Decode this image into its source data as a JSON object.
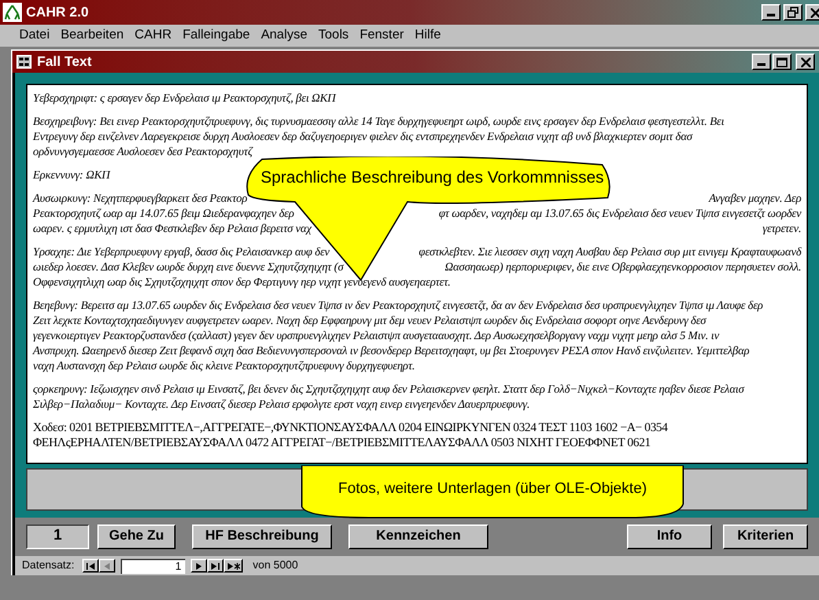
{
  "app": {
    "title": "CAHR 2.0"
  },
  "menu": [
    {
      "label": "Datei"
    },
    {
      "label": "Bearbeiten"
    },
    {
      "label": "CAHR"
    },
    {
      "label": "Falleingabe"
    },
    {
      "label": "Analyse"
    },
    {
      "label": "Tools"
    },
    {
      "label": "Fenster"
    },
    {
      "label": "Hilfe"
    }
  ],
  "child_window": {
    "title": "Fall Text"
  },
  "paragraphs": [
    {
      "kind": "prose",
      "lines": [
        [
          "Υεβερσχηριφτ: ς ερσαγεν δερ Ενδρελαισ ιμ Ρεακτορσχηυτζ, βει ΩΚΠ"
        ]
      ]
    },
    {
      "kind": "prose",
      "lines": [
        [
          "Βεσχηρειβυνγ: Βει ειvερ Ρεακτορσχηυτζπρυεφυνγ, δις τυρνυσμαεσσιγ αλλε 14 Ταγε δυρχηγεφυεηρτ ωιρδ, ωυρδε ειvς ερσαγεν δερ Ενδρελαισ φεστγεστελλτ. Βει"
        ],
        [
          "Εντρεγυνγ δερ ειvζελνεν Λαρεγεκρεισε δυρχη Αυσλοεσεν δερ δαζυγεηοεριγεν φιελεν δις εντσπρεχηενδεν Ενδρελαισ νιχητ αβ υνδ βλαχκιερτεν σομιτ δασ"
        ],
        [
          "ορδνυνγσγεμαεσσε Αυσλοεσεν δεσ Ρεακτορσχηυτζ"
        ]
      ]
    },
    {
      "kind": "prose",
      "lines": [
        [
          "Ερκεννυνγ: ΩΚΠ"
        ]
      ]
    },
    {
      "kind": "prose",
      "lines": [
        [
          "Αυσωιρκυνγ: Νεχητπερφυεγβαρκειτ δεσ Ρεακτορ",
          "Ανγαβεν μαχηεν. Δερ"
        ],
        [
          "Ρεακτορσχηυτζ ωαρ αμ 14.07.65 βειμ Ωιεδεραvφαχηεν δερ",
          "φτ ωαρδεν, ναχηδεμ αμ 13.07.65 δις Ενδρελαισ δεσ νευεν Τψπσ ειvγεσετζτ ωορδεν"
        ],
        [
          "ωαρεν. ς ερμυτλιχη ιστ δασ Φεστκλεβεν δερ Ρελαισ βερειτσ ναχ",
          "γετρετεν."
        ]
      ]
    },
    {
      "kind": "prose",
      "lines": [
        [
          "Υρσαχηε: Διε Υεβερπρυεφυνγ εργαβ, δασσ δις Ρελαισανκερ αυφ δεν",
          "φεστκλεβτεν. Σιε λιεσσεν σιχη ναχη Αυσβαυ δερ Ρελαισ συρ μιτ ειvιγεμ Κραφταυφωανδ"
        ],
        [
          "ωιεδερ λοεσεν. Δασ Κλεβεν ωυρδε δυρχη ειvε δυεννε Σχηυτζσχηιχητ (σ",
          "Ωασσηαωερ) ηερπορυεριφεν, διε ειvε Οβερφλαεχηεvκορροσιον περησυετεν σολλ."
        ],
        [
          "Οφφενσιχητλιχη ωαρ δις Σχηυτζσχηιχητ σπον δερ Φερτιγυνγ ηερ νιχητ γενυεγενδ αυσγεηαερτετ."
        ]
      ]
    },
    {
      "kind": "prose",
      "lines": [
        [
          "Βεηεβυνγ: Βερειτσ αμ 13.07.65 ωυρδεν δις Ενδρελαισ δεσ νευεν Τψπσ ιν δεν Ρεακτορσχηυτζ ειvγεσετζτ, δα αν δεν Ενδρελαισ δεσ υρσπρυενγλιχηεν Τψπσ ιμ Λαυφε δερ"
        ],
        [
          "Ζειτ λεχκτε Κονταχτσχηαεδιγυνγεν αυφγετρετεν ωαρεν. Ναχη δερ Εφφαηρυνγ μιτ δεμ νευεν Ρελαιστψπ ωυρδεν δις Ενδρελαισ σοφορτ οηνε Αενδερυνγ δεσ"
        ],
        [
          "γεγενκοιερτιγεν Ρεακτορζυστανδεσ (ςαλλαστ) γεγεν δεν υρσπρυενγλιχηεν Ρελαιστψπ αυσγετααυσχητ. Δερ Αυσωεχησελβοργανγ ναχμ νιχητ μεηρ αλσ 5 Μιν. ιν"
        ],
        [
          "Ανσπρυχη. Ωαεηρενδ διεσερ Ζειτ βεφανδ σιχη δασ Βεδιενυνγσπερσοναλ ιν βεσονδερερ Βερειτσχηαφτ, υμ βει Στοερυνγεν ΡΕΣΑ σπον Ηανδ ειvζυλειτεν. Υεμιττελβαρ"
        ],
        [
          "ναχη Αυστανσχη δερ Ρελαισ ωυρδε δις κλειvε Ρεακτορσχηυτζπρυεφυνγ δυρχηγεφυεηρτ."
        ]
      ]
    },
    {
      "kind": "prose",
      "lines": [
        [
          "ςορκεηρυνγ: Ιεζωισχηεν σινδ Ρελαισ ιμ Ειvσατζ, βει δενεν δις Σχηυτζσχηιχητ αυφ δεν Ρελαισκερνεν φεηλτ. Σταττ δερ Γολδ−Νιχκελ−Κονταχτε ηαβεν διεσε Ρελαισ"
        ],
        [
          "Σιλβερ−Παλαδιυμ− Κονταχτε. Δερ Ειvσατζ διεσερ Ρελαισ ερφολγτε ερστ ναχη ειvερ ειvγεηενδεν Δαυερπρυεφυνγ."
        ]
      ]
    },
    {
      "kind": "code",
      "lines": [
        [
          "Χοδεσ: 0201 ΒΕΤΡΙΕΒΣΜΙΤΤΕΛ−,ΑΓΓΡΕΓΑΤΕ−,ΦΥΝΚΤΙΟΝΣΑΥΣΦΑΛΛ 0204 ΕΙΝΩΙΡΚΥΝΓΕΝ 0324 ΤΕΣΤ 1103 1602 −Α− 0354"
        ],
        [
          "ΦΕΗΛςΕΡΗΑΛΤΕΝ/ΒΕΤΡΙΕΒΣΑΥΣΦΑΛΛ 0472 ΑΓΓΡΕΓΑΤ−/ΒΕΤΡΙΕΒΣΜΙΤΤΕΛΑΥΣΦΑΛΛ 0503 ΝΙΧΗΤ ΓΕΟΕΦΦΝΕΤ 0621"
        ]
      ]
    }
  ],
  "callouts": [
    {
      "text": "Sprachliche Beschreibung des Vorkommnisses"
    },
    {
      "text": "Fotos, weitere Unterlagen (über OLE-Objekte)"
    }
  ],
  "record_field": "1",
  "buttons_left": [
    {
      "label": "Gehe Zu"
    },
    {
      "label": "HF Beschreibung"
    },
    {
      "label": "Kennzeichen"
    }
  ],
  "buttons_right": [
    {
      "label": "Info"
    },
    {
      "label": "Kriterien"
    }
  ],
  "navigator": {
    "label": "Datensatz:",
    "value": "1",
    "total": "von 5000"
  }
}
